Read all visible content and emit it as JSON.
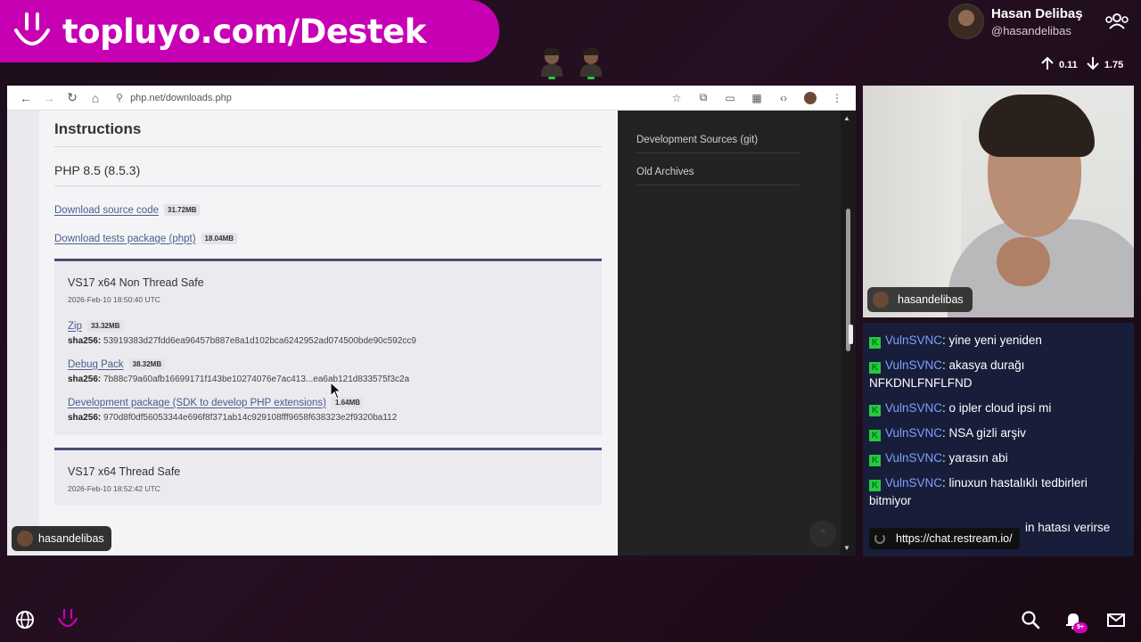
{
  "banner": {
    "text": "topluyo.com/Destek"
  },
  "profile": {
    "name": "Hasan Delibaş",
    "handle": "@hasandelibas"
  },
  "stats": {
    "up": "0.11",
    "down": "1.75"
  },
  "browser": {
    "url": "php.net/downloads.php"
  },
  "page": {
    "instructions": "Instructions",
    "version": "PHP 8.5 (8.5.3)",
    "downloads": [
      {
        "label": "Download source code",
        "size": "31.72MB"
      },
      {
        "label": "Download tests package (phpt)",
        "size": "18.04MB"
      }
    ],
    "cards": [
      {
        "title": "VS17 x64 Non Thread Safe",
        "date": "2026-Feb-10 18:50:40 UTC",
        "rows": [
          {
            "label": "Zip",
            "size": "33.32MB",
            "sha_label": "sha256:",
            "sha": "53919383d27fdd6ea96457b887e8a1d102bca6242952ad074500bde90c592cc9"
          },
          {
            "label": "Debug Pack",
            "size": "38.32MB",
            "sha_label": "sha256:",
            "sha": "7b88c79a60afb16699171f143be10274076e7ac413...ea6ab121d833575f3c2a"
          },
          {
            "label": "Development package (SDK to develop PHP extensions)",
            "size": "1.64MB",
            "sha_label": "sha256:",
            "sha": "970d8f0df56053344e696f8f371ab14c929108fff9658f638323e2f9320ba112"
          }
        ]
      },
      {
        "title": "VS17 x64 Thread Safe",
        "date": "2026-Feb-10 18:52:42 UTC"
      }
    ],
    "sidebar": [
      "Development Sources (git)",
      "Old Archives"
    ]
  },
  "host_tag": "hasandelibas",
  "cam_tag": "hasandelibas",
  "chat": {
    "messages": [
      {
        "user": "VulnSVNC",
        "text": "yine yeni yeniden"
      },
      {
        "user": "VulnSVNC",
        "text": "akasya durağı NFKDNLFNFLFND"
      },
      {
        "user": "VulnSVNC",
        "text": "o ipler cloud ipsi mi"
      },
      {
        "user": "VulnSVNC",
        "text": "NSA gizli arşiv"
      },
      {
        "user": "VulnSVNC",
        "text": "yarasın abi"
      },
      {
        "user": "VulnSVNC",
        "text": "linuxun hastalıklı tedbirleri bitmiyor"
      }
    ],
    "partial": "in hatası verirse",
    "link": "https://chat.restream.io/"
  },
  "bottom": {
    "badge": "9+"
  },
  "colors": {
    "banner": "#c800b4",
    "chat_bg": "#181d3a",
    "chat_user": "#7fa0ff",
    "card_border": "#474c74",
    "link": "#4b5d8c"
  }
}
